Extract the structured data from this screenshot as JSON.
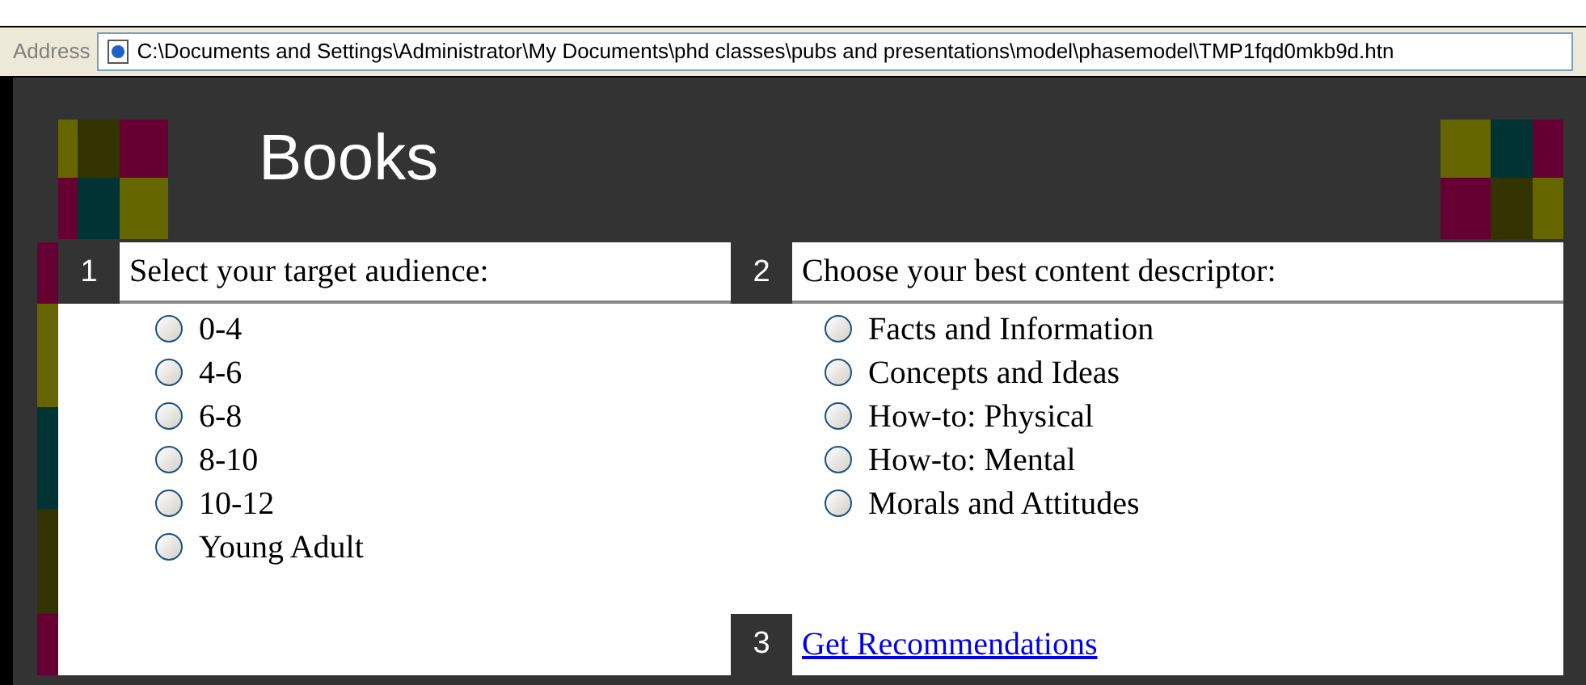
{
  "address_bar": {
    "label": "Address",
    "url": "C:\\Documents and Settings\\Administrator\\My Documents\\phd classes\\pubs and presentations\\model\\phasemodel\\TMP1fqd0mkb9d.htn"
  },
  "page_title": "Books",
  "sections": [
    {
      "number": "1",
      "heading": "Select your target audience:",
      "options": [
        {
          "label": "0-4",
          "selected": false
        },
        {
          "label": "4-6",
          "selected": false
        },
        {
          "label": "6-8",
          "selected": false
        },
        {
          "label": "8-10",
          "selected": false
        },
        {
          "label": "10-12",
          "selected": false
        },
        {
          "label": "Young Adult",
          "selected": false
        }
      ]
    },
    {
      "number": "2",
      "heading": "Choose your best content descriptor:",
      "options": [
        {
          "label": "Facts and Information",
          "selected": false
        },
        {
          "label": "Concepts and Ideas",
          "selected": false
        },
        {
          "label": "How-to: Physical",
          "selected": false
        },
        {
          "label": "How-to: Mental",
          "selected": false
        },
        {
          "label": "Morals and Attitudes",
          "selected": false
        }
      ]
    }
  ],
  "action": {
    "number": "3",
    "link": "Get Recommendations"
  }
}
